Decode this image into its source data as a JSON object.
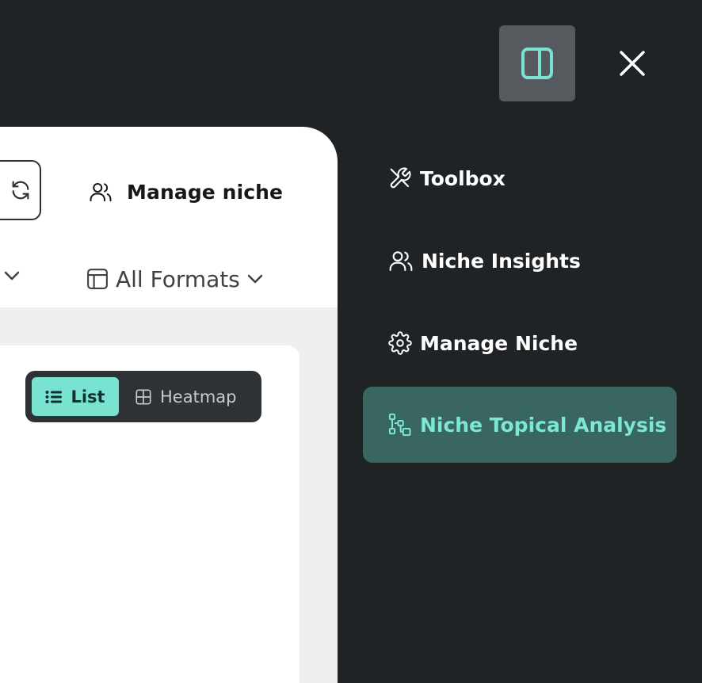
{
  "window": {
    "toggle_panel_icon": "sidebar-panel-icon",
    "close_icon": "close-icon"
  },
  "card": {
    "manage_niche_label": "Manage niche",
    "formats_label": "All Formats"
  },
  "view_toggle": {
    "list_label": "List",
    "heatmap_label": "Heatmap",
    "selected": "List"
  },
  "menu": {
    "items": [
      {
        "label": "Toolbox",
        "icon": "tools-icon"
      },
      {
        "label": "Niche Insights",
        "icon": "users-icon"
      },
      {
        "label": "Manage Niche",
        "icon": "gear-icon"
      },
      {
        "label": "Niche Topical Analysis",
        "icon": "topical-analysis-icon",
        "active": true
      }
    ]
  },
  "colors": {
    "background": "#202326",
    "accent": "#79e3d2",
    "active_item_bg": "#396660"
  }
}
